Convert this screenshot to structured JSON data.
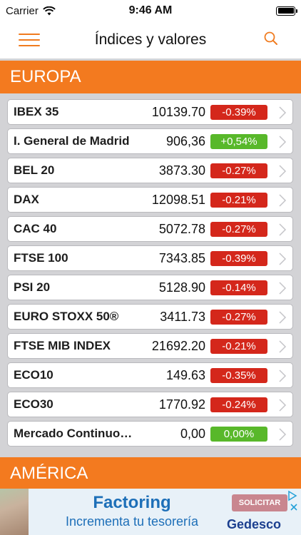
{
  "status_bar": {
    "carrier": "Carrier",
    "time": "9:46 AM"
  },
  "nav": {
    "title": "Índices y valores",
    "menu_icon": "hamburger-menu-icon",
    "search_icon": "search-icon"
  },
  "sections": {
    "europa": "EUROPA",
    "america": "AMÉRICA"
  },
  "colors": {
    "accent": "#f37a1f",
    "negative": "#d4271b",
    "positive": "#58b82a",
    "background": "#d3d3d6"
  },
  "rows": [
    {
      "name": "IBEX 35",
      "value": "10139.70",
      "change": "-0.39%",
      "trend": "neg"
    },
    {
      "name": "I. General de Madrid",
      "value": "906,36",
      "change": "+0,54%",
      "trend": "pos"
    },
    {
      "name": "BEL 20",
      "value": "3873.30",
      "change": "-0.27%",
      "trend": "neg"
    },
    {
      "name": "DAX",
      "value": "12098.51",
      "change": "-0.21%",
      "trend": "neg"
    },
    {
      "name": "CAC 40",
      "value": "5072.78",
      "change": "-0.27%",
      "trend": "neg"
    },
    {
      "name": "FTSE 100",
      "value": "7343.85",
      "change": "-0.39%",
      "trend": "neg"
    },
    {
      "name": "PSI 20",
      "value": "5128.90",
      "change": "-0.14%",
      "trend": "neg"
    },
    {
      "name": "EURO STOXX 50®",
      "value": "3411.73",
      "change": "-0.27%",
      "trend": "neg"
    },
    {
      "name": "FTSE MIB INDEX",
      "value": "21692.20",
      "change": "-0.21%",
      "trend": "neg"
    },
    {
      "name": "ECO10",
      "value": "149.63",
      "change": "-0.35%",
      "trend": "neg"
    },
    {
      "name": "ECO30",
      "value": "1770.92",
      "change": "-0.24%",
      "trend": "neg"
    },
    {
      "name": "Mercado Continuo…",
      "value": "0,00",
      "change": "0,00%",
      "trend": "pos"
    }
  ],
  "ad": {
    "title": "Factoring",
    "subtitle": "Incrementa tu tesorería",
    "cta": "SOLICITAR",
    "brand": "Gedesco"
  }
}
